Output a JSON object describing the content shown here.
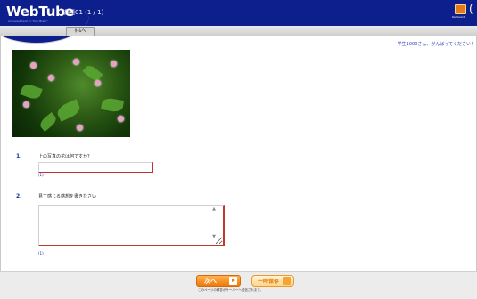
{
  "header": {
    "logo": "WebTube",
    "tagline": "An investment in \"Your Brain\"",
    "assignment_title": "課題01 (1 / 1)",
    "keyboard_label": "Keyboard"
  },
  "toolbar": {
    "home_label": "ﾎｰﾑへ"
  },
  "welcome": "学生1000さん、がんばってください！",
  "questions": [
    {
      "number": "1.",
      "text": "上の写真の花は何ですか？",
      "hint": "(1)"
    },
    {
      "number": "2.",
      "text": "見て感じる感想を書きなさい",
      "hint": "(1)"
    }
  ],
  "answers": {
    "q1_value": "",
    "q2_value": ""
  },
  "footer": {
    "next_label": "次へ",
    "save_label": "一時保存",
    "note": "このページの解答がサーバーへ送信されます。"
  }
}
